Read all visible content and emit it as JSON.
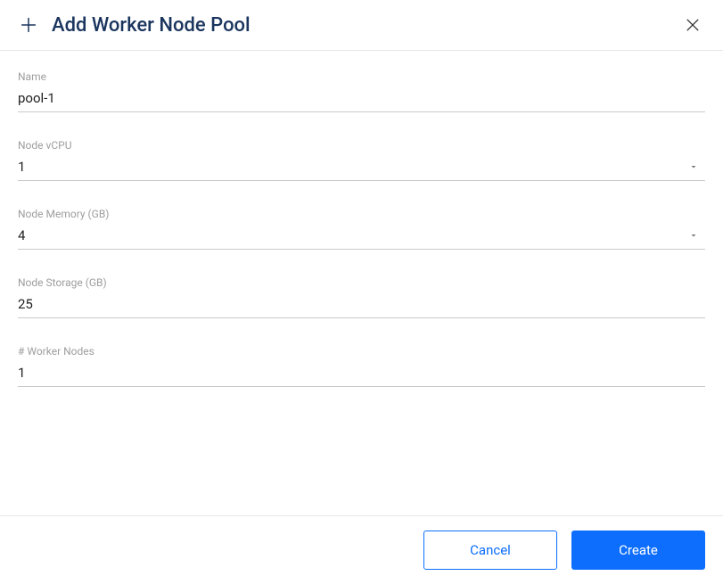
{
  "header": {
    "title": "Add Worker Node Pool"
  },
  "fields": {
    "name": {
      "label": "Name",
      "value": "pool-1"
    },
    "vcpu": {
      "label": "Node vCPU",
      "value": "1"
    },
    "memory": {
      "label": "Node Memory (GB)",
      "value": "4"
    },
    "storage": {
      "label": "Node Storage (GB)",
      "value": "25"
    },
    "workers": {
      "label": "# Worker Nodes",
      "value": "1"
    }
  },
  "footer": {
    "cancel": "Cancel",
    "create": "Create"
  }
}
